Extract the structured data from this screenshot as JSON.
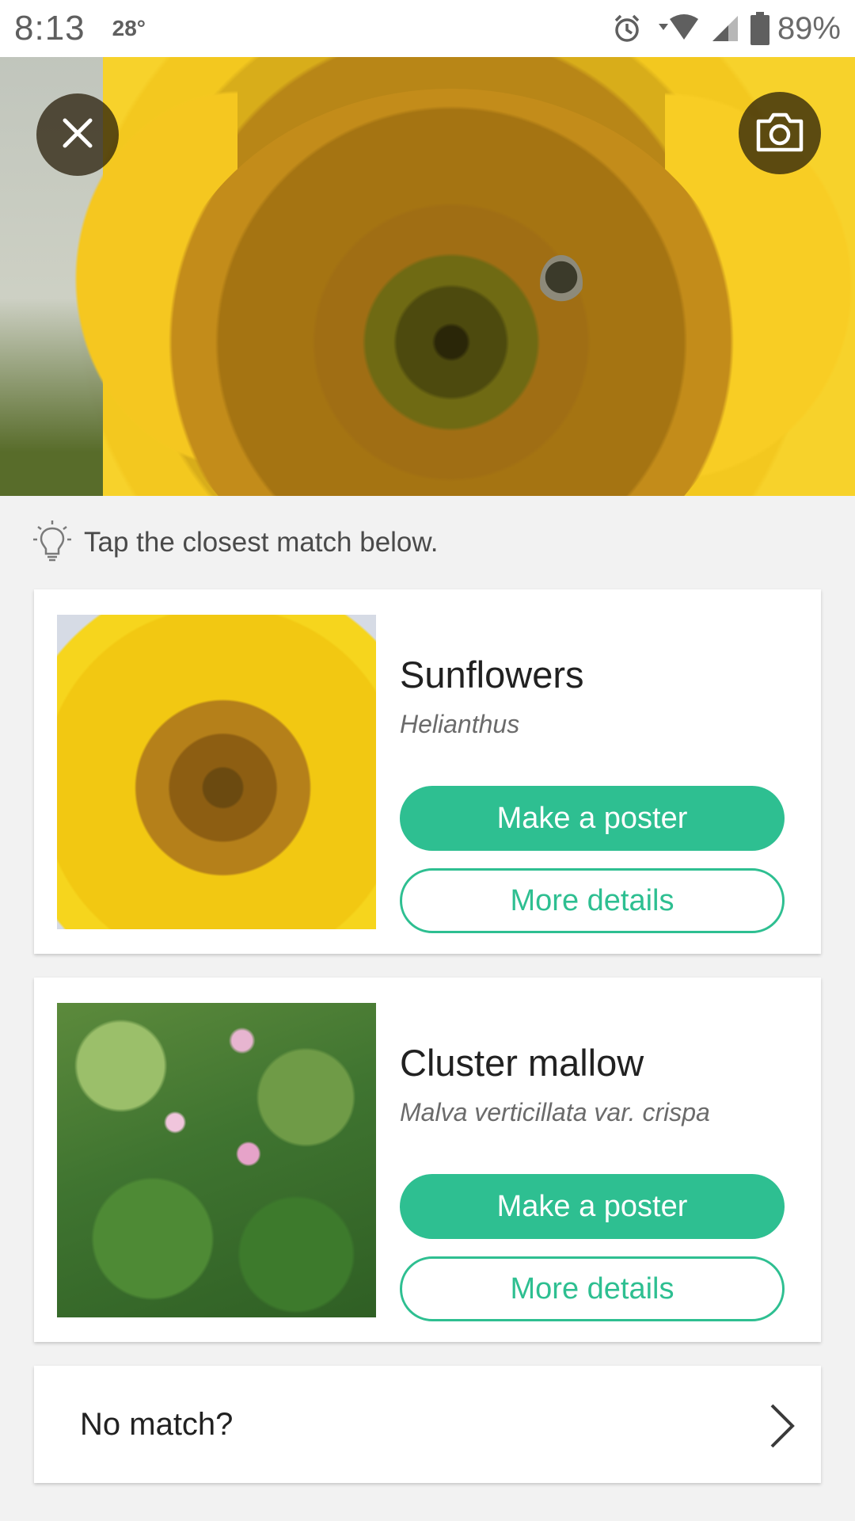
{
  "status_bar": {
    "time": "8:13",
    "temperature": "28°",
    "battery": "89%",
    "icons": [
      "alarm-icon",
      "wifi-icon",
      "signal-icon",
      "battery-icon"
    ]
  },
  "hero": {
    "close_icon": "close-icon",
    "camera_icon": "camera-icon"
  },
  "hint": {
    "icon": "lightbulb-icon",
    "text": "Tap the closest match below."
  },
  "matches": [
    {
      "common_name": "Sunflowers",
      "scientific_name": "Helianthus",
      "primary_label": "Make a poster",
      "secondary_label": "More details"
    },
    {
      "common_name": "Cluster mallow",
      "scientific_name": "Malva verticillata var. crispa",
      "primary_label": "Make a poster",
      "secondary_label": "More details"
    }
  ],
  "no_match": {
    "label": "No match?",
    "icon": "chevron-right-icon"
  },
  "colors": {
    "accent": "#2ebf91",
    "background": "#f2f2f2",
    "card": "#ffffff"
  }
}
